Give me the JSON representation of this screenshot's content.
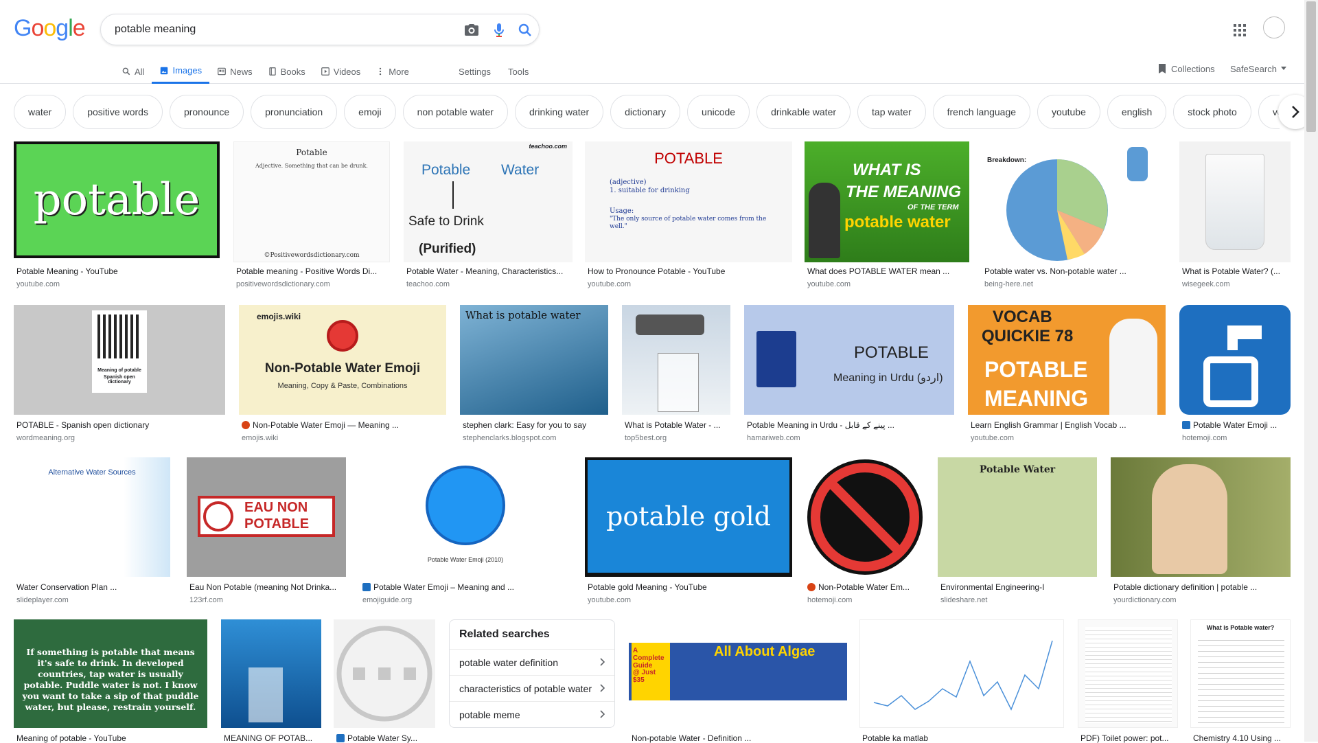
{
  "logo": {
    "letters": [
      "G",
      "o",
      "o",
      "g",
      "l",
      "e"
    ],
    "colors": [
      "#4285f4",
      "#ea4335",
      "#fbbc05",
      "#4285f4",
      "#34a853",
      "#ea4335"
    ]
  },
  "search": {
    "query": "potable meaning"
  },
  "tabs": [
    {
      "label": "All"
    },
    {
      "label": "Images"
    },
    {
      "label": "News"
    },
    {
      "label": "Books"
    },
    {
      "label": "Videos"
    },
    {
      "label": "More"
    }
  ],
  "tools": {
    "settings": "Settings",
    "tools": "Tools",
    "collections": "Collections",
    "safesearch": "SafeSearch"
  },
  "chips": [
    "water",
    "positive words",
    "pronounce",
    "pronunciation",
    "emoji",
    "non potable water",
    "drinking water",
    "dictionary",
    "unicode",
    "drinkable water",
    "tap water",
    "french language",
    "youtube",
    "english",
    "stock photo",
    "vocab"
  ],
  "results": {
    "r1": {
      "title": "Potable Meaning - YouTube",
      "domain": "youtube.com",
      "text": "potable"
    },
    "r2": {
      "title": "Potable meaning - Positive Words Di...",
      "domain": "positivewordsdictionary.com",
      "text": "Potable",
      "text2": "Adjective. Something that can be drunk.",
      "text3": "©Positivewordsdictionary.com"
    },
    "r3": {
      "title": "Potable Water - Meaning, Characteristics...",
      "domain": "teachoo.com",
      "text": "Potable",
      "text2": "Water",
      "text3": "Safe to Drink",
      "text4": "(Purified)",
      "text5": "teachoo.com"
    },
    "r4": {
      "title": "How to Pronounce Potable - YouTube",
      "domain": "youtube.com",
      "text": "POTABLE",
      "text2": "(adjective)",
      "text3": "1. suitable for drinking",
      "text4": "Usage:",
      "text5": "\"The only source of potable water comes from the well.\""
    },
    "r5": {
      "title": "What does POTABLE WATER mean ...",
      "domain": "youtube.com",
      "text": "WHAT IS",
      "text2": "THE MEANING",
      "text3": "OF THE TERM",
      "text4": "potable water"
    },
    "r6": {
      "title": "Potable water vs. Non-potable water ...",
      "domain": "being-here.net",
      "text": "Breakdown:"
    },
    "r7": {
      "title": "What is Potable Water? (...",
      "domain": "wisegeek.com"
    },
    "r8": {
      "title": "POTABLE - Spanish open dictionary",
      "domain": "wordmeaning.org",
      "text": "Meaning of potable",
      "text2": "Spanish open dictionary"
    },
    "r9": {
      "title": "Non-Potable Water Emoji — Meaning ...",
      "domain": "emojis.wiki",
      "text": "emojis.wiki",
      "text2": "Non-Potable Water Emoji",
      "text3": "Meaning, Copy & Paste, Combinations"
    },
    "r10": {
      "title": "stephen clark: Easy for you to say",
      "domain": "stephenclarks.blogspot.com",
      "text": "What is potable water"
    },
    "r11": {
      "title": "What is Potable Water - ...",
      "domain": "top5best.org"
    },
    "r12": {
      "title": "Potable Meaning in Urdu - پینے کے قابل ...",
      "domain": "hamariweb.com",
      "text": "POTABLE",
      "text2": "Meaning in Urdu (اردو)"
    },
    "r13": {
      "title": "Learn English Grammar | English Vocab ...",
      "domain": "youtube.com",
      "text": "VOCAB",
      "text2": "QUICKIE 78",
      "text3": "POTABLE",
      "text4": "MEANING"
    },
    "r14": {
      "title": "Potable Water Emoji ...",
      "domain": "hotemoji.com"
    },
    "r15": {
      "title": "Water Conservation Plan ...",
      "domain": "slideplayer.com",
      "text": "Alternative Water Sources"
    },
    "r16": {
      "title": "Eau Non Potable (meaning Not Drinka...",
      "domain": "123rf.com",
      "text": "EAU NON",
      "text2": "POTABLE"
    },
    "r17": {
      "title": "Potable Water Emoji – Meaning and ...",
      "domain": "emojiguide.org",
      "text": "Potable Water Emoji (2010)"
    },
    "r18": {
      "title": "Potable gold Meaning - YouTube",
      "domain": "youtube.com",
      "text": "potable gold"
    },
    "r19": {
      "title": "Non-Potable Water Em...",
      "domain": "hotemoji.com"
    },
    "r20": {
      "title": "Environmental Engineering-I",
      "domain": "slideshare.net",
      "text": "Potable Water"
    },
    "r21": {
      "title": "Potable dictionary definition | potable ...",
      "domain": "yourdictionary.com"
    },
    "r22": {
      "title": "Meaning of potable - YouTube",
      "domain": "",
      "text": "If something is potable that means it's safe to drink. In developed countries, tap water is usually potable. Puddle water is not. I know you want to take a sip of that puddle water, but please, restrain yourself."
    },
    "r23": {
      "title": "MEANING OF POTAB...",
      "domain": ""
    },
    "r24": {
      "title": "Potable Water Sy...",
      "domain": ""
    },
    "r25": {
      "title": "Non-potable Water - Definition ...",
      "domain": "",
      "text": "All About Algae",
      "text2": "A Complete Guide",
      "text3": "@ Just $35"
    },
    "r26": {
      "title": "Potable ka matlab",
      "domain": ""
    },
    "r27": {
      "title": "PDF) Toilet power: pot...",
      "domain": ""
    },
    "r28": {
      "title": "Chemistry 4.10 Using ...",
      "domain": "",
      "text": "What is Potable water?"
    }
  },
  "related": {
    "title": "Related searches",
    "items": [
      "potable water definition",
      "characteristics of potable water",
      "potable meme"
    ]
  }
}
